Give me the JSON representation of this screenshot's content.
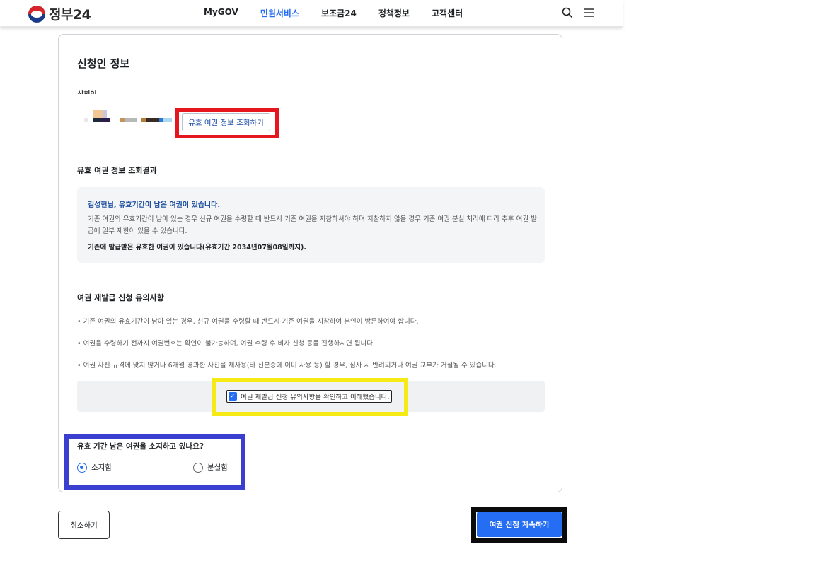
{
  "header": {
    "logo_text": "정부24",
    "nav": [
      {
        "label": "MyGOV",
        "active": false
      },
      {
        "label": "민원서비스",
        "active": true
      },
      {
        "label": "보조금24",
        "active": false
      },
      {
        "label": "정책정보",
        "active": false
      },
      {
        "label": "고객센터",
        "active": false
      }
    ],
    "icons": [
      "search-icon",
      "menu-icon"
    ]
  },
  "card": {
    "title": "신청인 정보",
    "applicant_label": "신청인",
    "query_button": "유효 여권 정보 조회하기",
    "result_section_title": "유효 여권 정보 조회결과",
    "result": {
      "headline": "김성현님, 유효기간이 남은 여권이 있습니다.",
      "body": "기존 여권의 유효기간이 남아 있는 경우 신규 여권을 수령할 때 반드시 기존 여권을 지참하셔야 하며 지참하지 않을 경우 기존 여권 분실 처리에 따라 추후 여권 발급에 일부 제한이 있을 수 있습니다.",
      "strong": "기존에 발급받은 유효한 여권이 있습니다(유효기간 2034년07월08일까지)."
    },
    "notice_section_title": "여권 재발급 신청 유의사항",
    "notices": [
      "• 기존 여권의 유효기간이 남아 있는 경우, 신규 여권을 수령할 때 반드시 기존 여권을 지참하여 본인이 방문하여야 합니다.",
      "• 여권을 수령하기 전까지 여권번호는 확인이 불가능하며, 여권 수령 후 비자 신청 등을 진행하시면 됩니다.",
      "• 여권 사진 규격에 맞지 않거나 6개월 경과한 사진을 재사용(타 신분증에 이미 사용 등) 할 경우, 심사 시 반려되거나 여권 교부가 거절될 수 있습니다."
    ],
    "agree_label": "여권 재발급 신청 유의사항을 확인하고 이해했습니다.",
    "agree_checked": true,
    "question": "유효 기간 남은 여권을 소지하고 있나요?",
    "options": [
      {
        "label": "소지함",
        "selected": true
      },
      {
        "label": "분실함",
        "selected": false
      }
    ]
  },
  "footer": {
    "cancel": "취소하기",
    "continue": "여권 신청 계속하기"
  },
  "colors": {
    "accent": "#256ef4",
    "highlight_red": "#e5161d",
    "highlight_yellow": "#f5ea13",
    "highlight_blue": "#3b3fcf",
    "highlight_black": "#0b0b0b"
  }
}
